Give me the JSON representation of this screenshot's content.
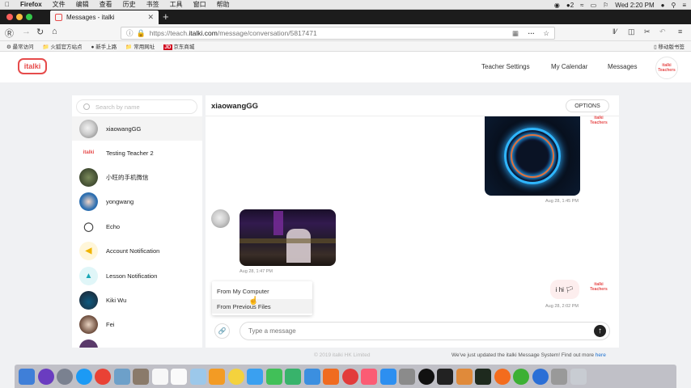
{
  "os_menubar": {
    "apple_icon": "apple-icon",
    "app": "Firefox",
    "items": [
      "文件",
      "编辑",
      "查看",
      "历史",
      "书签",
      "工具",
      "窗口",
      "帮助"
    ],
    "status": {
      "notification_count": "2",
      "clock": "Wed 2:20 PM"
    }
  },
  "browser": {
    "tab_title": "Messages - italki",
    "url_prefix": "https://teach.",
    "url_host": "italki.com",
    "url_path": "/message/conversation/5817471",
    "bookmarks": [
      "最常访问",
      "火狐官方站点",
      "新手上路",
      "常用网址",
      "京东商城"
    ],
    "bookmarks_right": "移动版书签"
  },
  "site": {
    "logo": "italki",
    "nav": [
      "Teacher Settings",
      "My Calendar",
      "Messages"
    ],
    "avatar_label_1": "italki",
    "avatar_label_2": "Teachers"
  },
  "sidebar": {
    "search_placeholder": "Search by name",
    "contacts": [
      {
        "name": "xiaowangGG"
      },
      {
        "name": "Testing Teacher 2",
        "avatar_text": "italki"
      },
      {
        "name": "小旺的手机微信"
      },
      {
        "name": "yongwang"
      },
      {
        "name": "Echo"
      },
      {
        "name": "Account Notification"
      },
      {
        "name": "Lesson Notification"
      },
      {
        "name": "Kiki Wu"
      },
      {
        "name": "Fei"
      }
    ]
  },
  "chat": {
    "title": "xiaowangGG",
    "options_label": "OPTIONS",
    "messages": [
      {
        "side": "right",
        "type": "image",
        "timestamp": "Aug 28, 1:45 PM"
      },
      {
        "side": "left",
        "type": "image",
        "timestamp": "Aug 28, 1:47 PM"
      },
      {
        "side": "right",
        "type": "text",
        "text": "i hi 🏳",
        "timestamp": "Aug 28, 2:02 PM"
      }
    ],
    "teacher_avatar_1": "italki",
    "teacher_avatar_2": "Teachers",
    "attach_menu": [
      "From My Computer",
      "From Previous Files"
    ],
    "input_placeholder": "Type a message"
  },
  "footer": {
    "copyright": "© 2019 italki HK Limited",
    "notice": "We've just updated the italki Message System! Find out more ",
    "notice_link": "here"
  },
  "colors": {
    "brand_red": "#e64b4b",
    "bubble_pink": "#fdeeee"
  }
}
